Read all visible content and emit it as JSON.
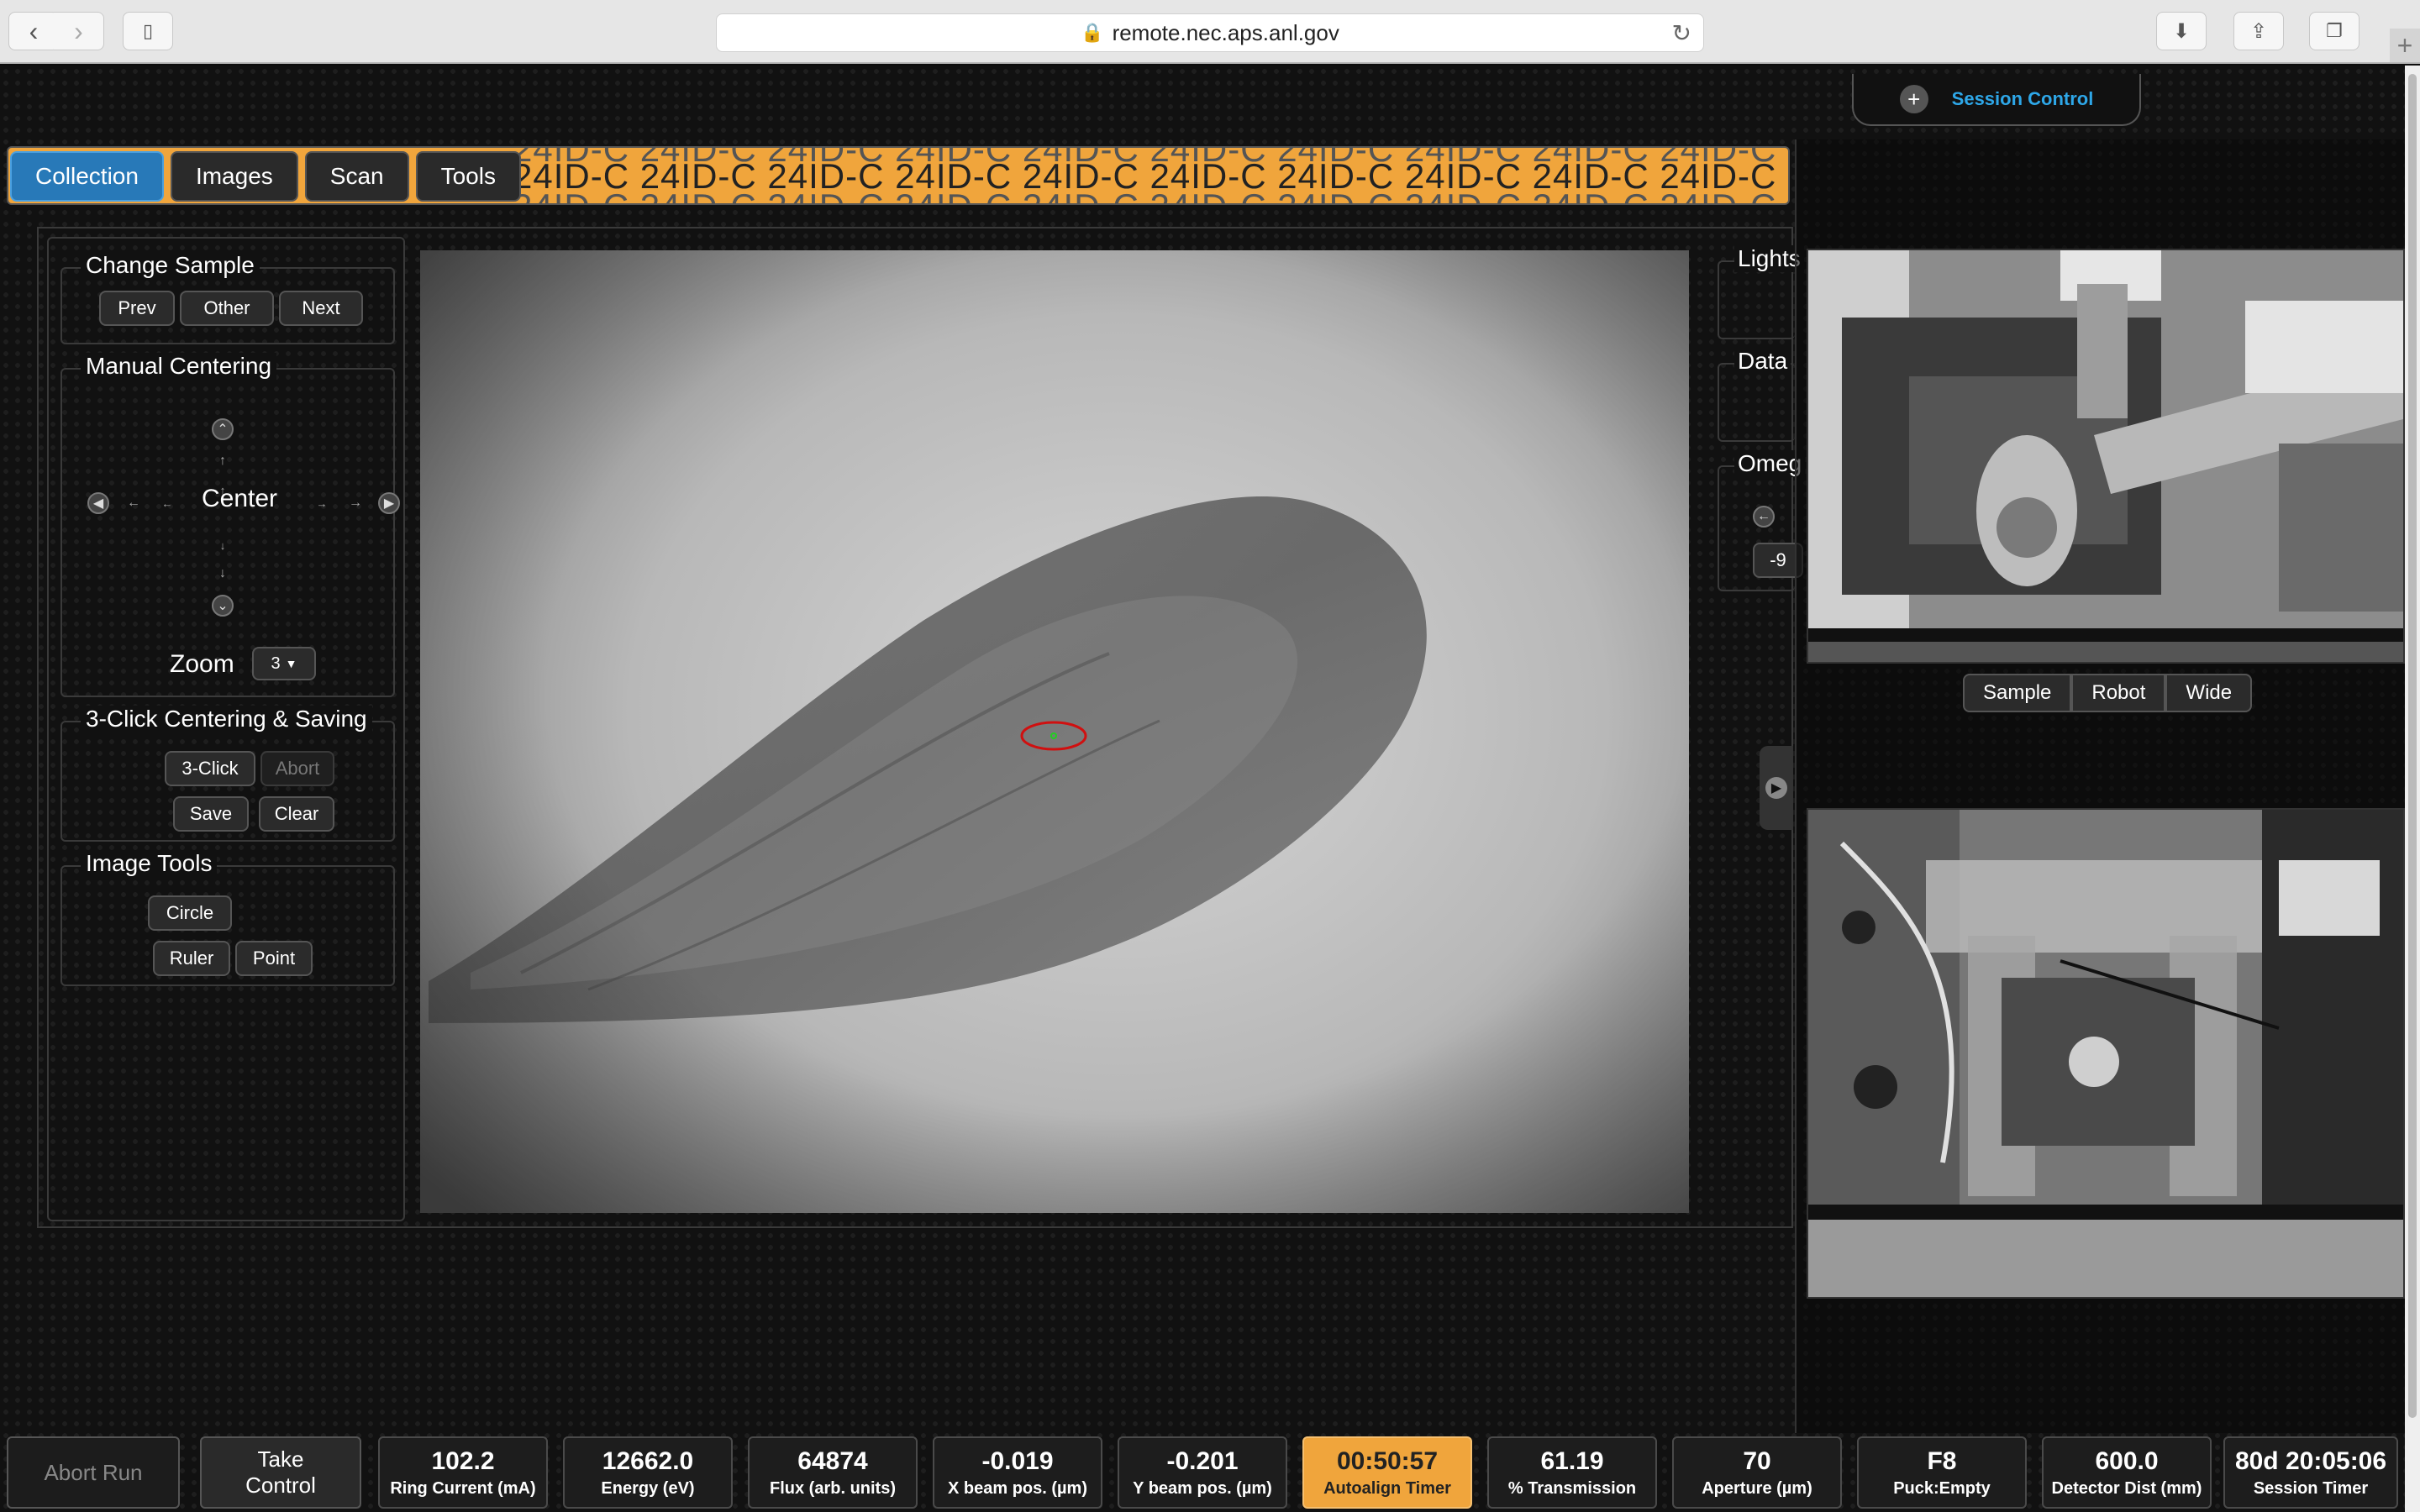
{
  "browser": {
    "url": "remote.nec.aps.anl.gov",
    "back_icon": "chevron-left-icon",
    "forward_icon": "chevron-right-icon"
  },
  "session": {
    "label": "Session Control"
  },
  "banner": {
    "text": "24ID-C  24ID-C  24ID-C  24ID-C  24ID-C  24ID-C  24ID-C  24ID-C  24ID-C  24ID-C  24ID-C  24ID-C"
  },
  "tabs": [
    {
      "label": "Collection",
      "active": true
    },
    {
      "label": "Images"
    },
    {
      "label": "Scan"
    },
    {
      "label": "Tools"
    }
  ],
  "change_sample": {
    "title": "Change Sample",
    "prev": "Prev",
    "other": "Other",
    "next": "Next"
  },
  "manual_centering": {
    "title": "Manual Centering",
    "center": "Center",
    "zoom_label": "Zoom",
    "zoom_value": "3"
  },
  "three_click": {
    "title": "3-Click Centering & Saving",
    "three_click": "3-Click",
    "abort": "Abort",
    "save": "Save",
    "clear": "Clear"
  },
  "image_tools": {
    "title": "Image Tools",
    "circle": "Circle",
    "ruler": "Ruler",
    "point": "Point"
  },
  "right_panel": {
    "lights": "Lights",
    "data": "Data",
    "omega": "Omeg",
    "omega_value": "-9"
  },
  "video_tabs": [
    "Sample",
    "Robot",
    "Wide"
  ],
  "status": {
    "abort_run": "Abort Run",
    "take_control": "Take Control",
    "items": [
      {
        "value": "102.2",
        "label": "Ring Current (mA)"
      },
      {
        "value": "12662.0",
        "label": "Energy (eV)"
      },
      {
        "value": "64874",
        "label": "Flux (arb. units)"
      },
      {
        "value": "-0.019",
        "label": "X beam pos. (µm)"
      },
      {
        "value": "-0.201",
        "label": "Y beam pos. (µm)"
      },
      {
        "value": "00:50:57",
        "label": "Autoalign Timer",
        "highlight": true
      },
      {
        "value": "61.19",
        "label": "% Transmission"
      },
      {
        "value": "70",
        "label": "Aperture (µm)"
      },
      {
        "value": "F8",
        "label": "Puck:Empty"
      },
      {
        "value": "600.0",
        "label": "Detector Dist (mm)"
      },
      {
        "value": "80d 20:05:06",
        "label": "Session Timer"
      }
    ]
  }
}
